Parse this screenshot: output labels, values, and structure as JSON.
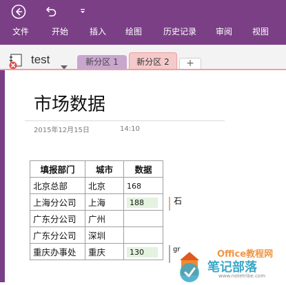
{
  "quick_access": {
    "back_icon": "back-circle-icon",
    "undo_icon": "undo-icon",
    "more_icon": "dropdown-caret-icon"
  },
  "ribbon": {
    "tabs": [
      "文件",
      "开始",
      "插入",
      "绘图",
      "历史记录",
      "审阅",
      "视图"
    ]
  },
  "notebook": {
    "name": "test",
    "icon": "notebook-sync-error-icon"
  },
  "sections": {
    "tabs": [
      {
        "label": "新分区 1",
        "active": false
      },
      {
        "label": "新分区 2",
        "active": true
      }
    ],
    "add_label": "+"
  },
  "page": {
    "title": "市场数据",
    "date": "2015年12月15日",
    "time": "14:10"
  },
  "table": {
    "headers": [
      "填报部门",
      "城市",
      "数据"
    ],
    "rows": [
      {
        "dept": "北京总部",
        "city": "北京",
        "value": "168",
        "highlight": false
      },
      {
        "dept": "上海分公司",
        "city": "上海",
        "value": "188",
        "highlight": true
      },
      {
        "dept": "广东分公司",
        "city": "广州",
        "value": "",
        "highlight": false
      },
      {
        "dept": "广东分公司",
        "city": "深圳",
        "value": "",
        "highlight": false
      },
      {
        "dept": "重庆办事处",
        "city": "重庆",
        "value": "130",
        "highlight": true
      }
    ]
  },
  "side_notes": {
    "stone": "石",
    "partial": "gr"
  },
  "watermark": {
    "line1": "Office教程网",
    "line2": "笔记部落",
    "url": "www.notetribe.com"
  },
  "colors": {
    "ribbon": "#7b3f86",
    "active_section": "#f6c9ca",
    "inactive_section": "#c8a6ce",
    "cell_highlight": "#e4f2e0"
  }
}
